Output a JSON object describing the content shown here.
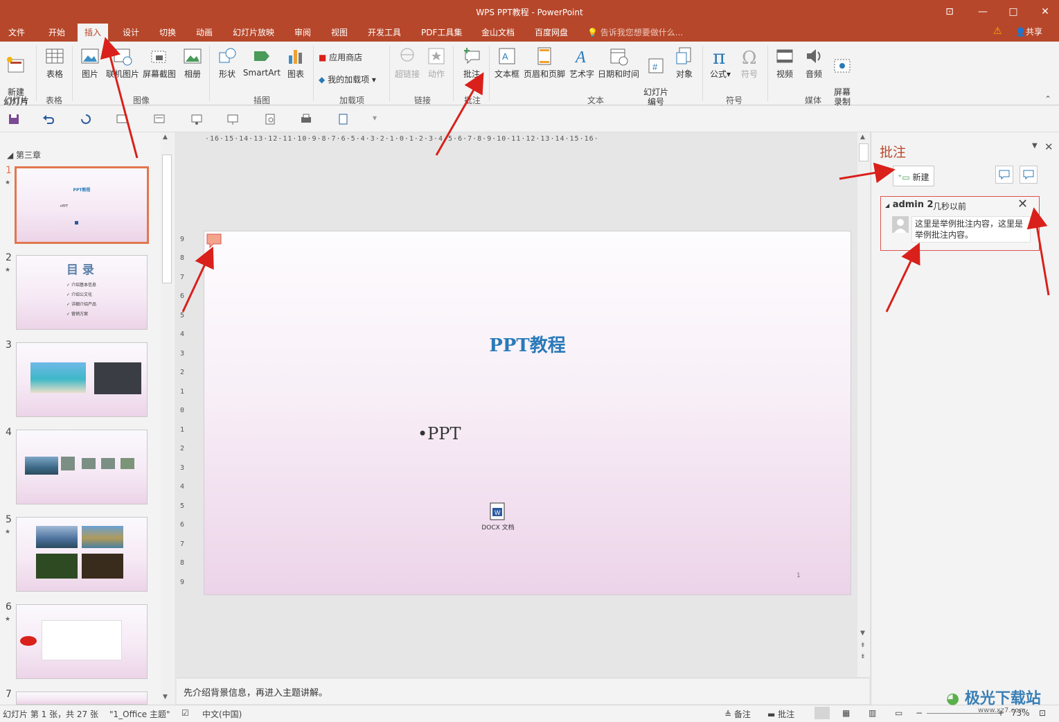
{
  "window": {
    "title": "WPS PPT教程 - PowerPoint",
    "restore_label": "⧉",
    "maximize_label": "□",
    "close_label": "✕",
    "ribbon_options_label": "⊡"
  },
  "tabs": [
    {
      "label": "文件"
    },
    {
      "label": "开始"
    },
    {
      "label": "插入"
    },
    {
      "label": "设计"
    },
    {
      "label": "切换"
    },
    {
      "label": "动画"
    },
    {
      "label": "幻灯片放映"
    },
    {
      "label": "审阅"
    },
    {
      "label": "视图"
    },
    {
      "label": "开发工具"
    },
    {
      "label": "PDF工具集"
    },
    {
      "label": "金山文档"
    },
    {
      "label": "百度网盘"
    }
  ],
  "tellme": "告诉我您想要做什么...",
  "share": "共享",
  "ribbon": {
    "new_slide": "新建\n幻灯片",
    "table": "表格",
    "picture": "图片",
    "online_picture": "联机图片",
    "screenshot": "屏幕截图",
    "album": "相册",
    "shapes": "形状",
    "smartart": "SmartArt",
    "chart": "图表",
    "app_store": "应用商店",
    "my_addins": "我的加载项",
    "hyperlink": "超链接",
    "action": "动作",
    "comment": "批注",
    "textbox": "文本框",
    "header_footer": "页眉和页脚",
    "wordart": "艺术字",
    "datetime": "日期和时间",
    "slide_number": "幻灯片\n编号",
    "object": "对象",
    "equation": "公式",
    "symbol": "符号",
    "video": "视频",
    "audio": "音频",
    "screen_record": "屏幕\n录制",
    "groups": {
      "slides": "幻灯片",
      "tables": "表格",
      "images": "图像",
      "illustrations": "插图",
      "addins": "加载项",
      "links": "链接",
      "comments": "批注",
      "text": "文本",
      "symbols": "符号",
      "media": "媒体"
    }
  },
  "thumbnails": {
    "section": "第三章",
    "items": [
      {
        "num": "1",
        "title": "PPT教程",
        "bullet": "•PPT"
      },
      {
        "num": "2",
        "title": "目 录",
        "items": [
          "介绍基本信息",
          "介绍公文化",
          "详细介绍产品",
          "营销方案"
        ]
      },
      {
        "num": "3"
      },
      {
        "num": "4"
      },
      {
        "num": "5"
      },
      {
        "num": "6"
      },
      {
        "num": "7"
      }
    ]
  },
  "slide": {
    "title": "PPT教程",
    "bullet": "•PPT",
    "attachment_label": "DOCX 文档",
    "page_number": "1"
  },
  "ruler_h": "·16·15·14·13·12·11·10·9·8·7·6·5·4·3·2·1·0·1·2·3·4·5·6·7·8·9·10·11·12·13·14·15·16·",
  "ruler_v": [
    "9",
    "8",
    "7",
    "6",
    "5",
    "4",
    "3",
    "2",
    "1",
    "0",
    "1",
    "2",
    "3",
    "4",
    "5",
    "6",
    "7",
    "8",
    "9"
  ],
  "notes": "先介绍背景信息，再进入主题讲解。",
  "comments_pane": {
    "title": "批注",
    "new_button": "新建",
    "comment": {
      "author": "admin 2",
      "time": "几秒以前",
      "text": "这里是举例批注内容，这里是举例批注内容。"
    }
  },
  "status": {
    "slide_info": "幻灯片 第 1 张，共 27 张",
    "theme": "\"1_Office 主题\"",
    "language": "中文(中国)",
    "notes_btn": "备注",
    "comments_btn": "批注",
    "zoom": "73%"
  },
  "watermark": {
    "main": "极光下载站",
    "sub": "www.xz7.com"
  },
  "colors": {
    "accent": "#b7472a",
    "ribbon_bg": "#f3f3f3",
    "slide_title": "#2a7ab8",
    "arrow": "#d9201a",
    "selected_thumb": "#e1774e"
  }
}
